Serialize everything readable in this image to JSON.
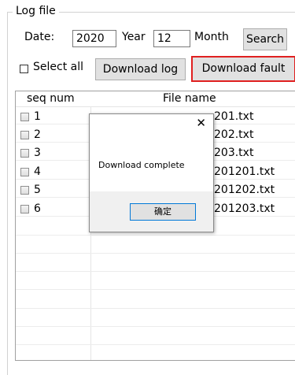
{
  "groupbox": {
    "title": "Log file"
  },
  "date_row": {
    "label": "Date:",
    "year_value": "2020",
    "year_label": "Year",
    "month_value": "12",
    "month_label": "Month",
    "search_label": "Search"
  },
  "actions": {
    "select_all_label": "Select all",
    "download_log_label": "Download log",
    "download_fault_label": "Download fault"
  },
  "table": {
    "columns": [
      "seq num",
      "File name"
    ],
    "rows": [
      {
        "seq": "1",
        "file": "201.txt"
      },
      {
        "seq": "2",
        "file": "202.txt"
      },
      {
        "seq": "3",
        "file": "203.txt"
      },
      {
        "seq": "4",
        "file": "201201.txt"
      },
      {
        "seq": "5",
        "file": "201202.txt"
      },
      {
        "seq": "6",
        "file": "201203.txt"
      }
    ]
  },
  "dialog": {
    "message": "Download complete",
    "ok_label": "确定",
    "close_glyph": "✕"
  },
  "colors": {
    "focus_border": "#e02020",
    "button_face": "#e1e1e1",
    "ok_border": "#0078d7"
  }
}
